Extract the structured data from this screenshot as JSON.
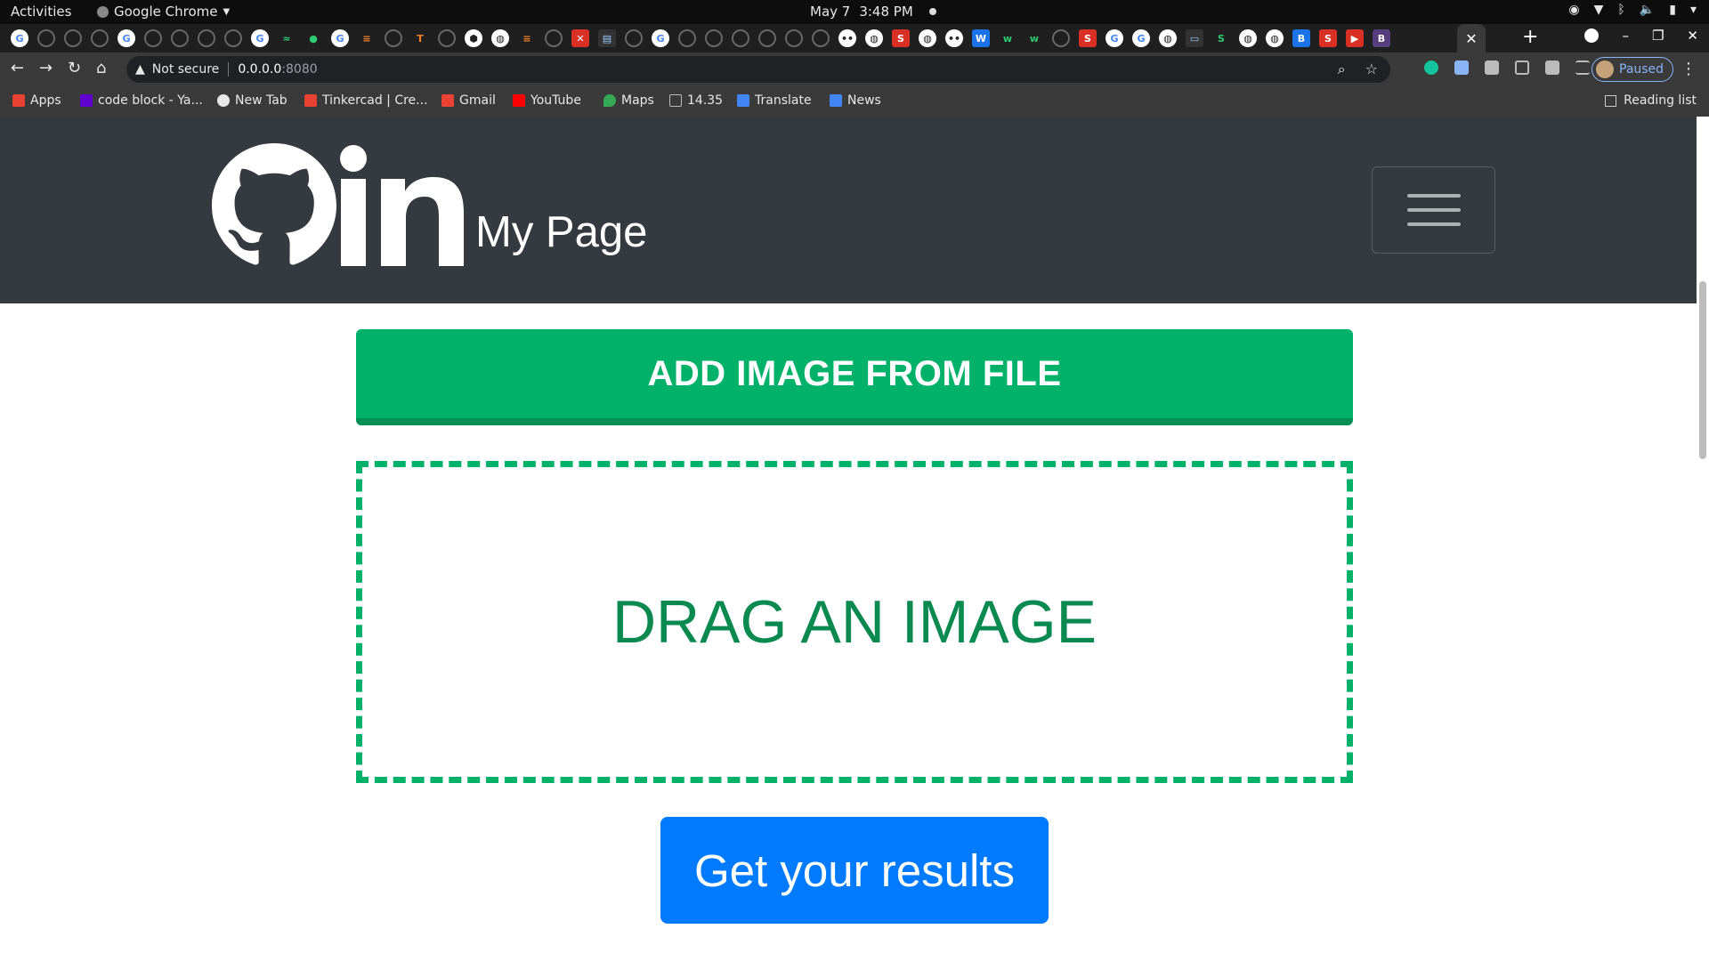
{
  "os": {
    "activities": "Activities",
    "app_name": "Google Chrome",
    "date": "May 7",
    "time": "3:48 PM"
  },
  "browser": {
    "security_label": "Not secure",
    "url_host": "0.0.0.0",
    "url_port": ":8080",
    "profile_status": "Paused",
    "bookmarks": [
      {
        "label": "Apps",
        "icon": "apps-grid-icon",
        "color": "#e94235"
      },
      {
        "label": "code block - Ya...",
        "icon": "yahoo-icon",
        "color": "#6001d2"
      },
      {
        "label": "New Tab",
        "icon": "globe-icon",
        "color": "#e8e8e8"
      },
      {
        "label": "Tinkercad | Cre...",
        "icon": "tinkercad-icon",
        "color": "#e94235"
      },
      {
        "label": "Gmail",
        "icon": "gmail-icon",
        "color": "#ea4335"
      },
      {
        "label": "YouTube",
        "icon": "youtube-icon",
        "color": "#ff0000"
      },
      {
        "label": "Maps",
        "icon": "maps-icon",
        "color": "#34a853"
      },
      {
        "label": "14.35",
        "icon": "cc-icon",
        "color": "#bbbbbb"
      },
      {
        "label": "Translate",
        "icon": "translate-icon",
        "color": "#4285f4"
      },
      {
        "label": "News",
        "icon": "news-icon",
        "color": "#4285f4"
      }
    ],
    "reading_list": "Reading list"
  },
  "page": {
    "brand_title": "My Page",
    "add_image_label": "ADD IMAGE FROM FILE",
    "drop_zone_label": "DRAG AN IMAGE",
    "results_label": "Get your results"
  },
  "colors": {
    "navbar": "#343a40",
    "add_button": "#00b16a",
    "drop_zone_text": "#0a8a50",
    "results_button": "#007bff"
  }
}
